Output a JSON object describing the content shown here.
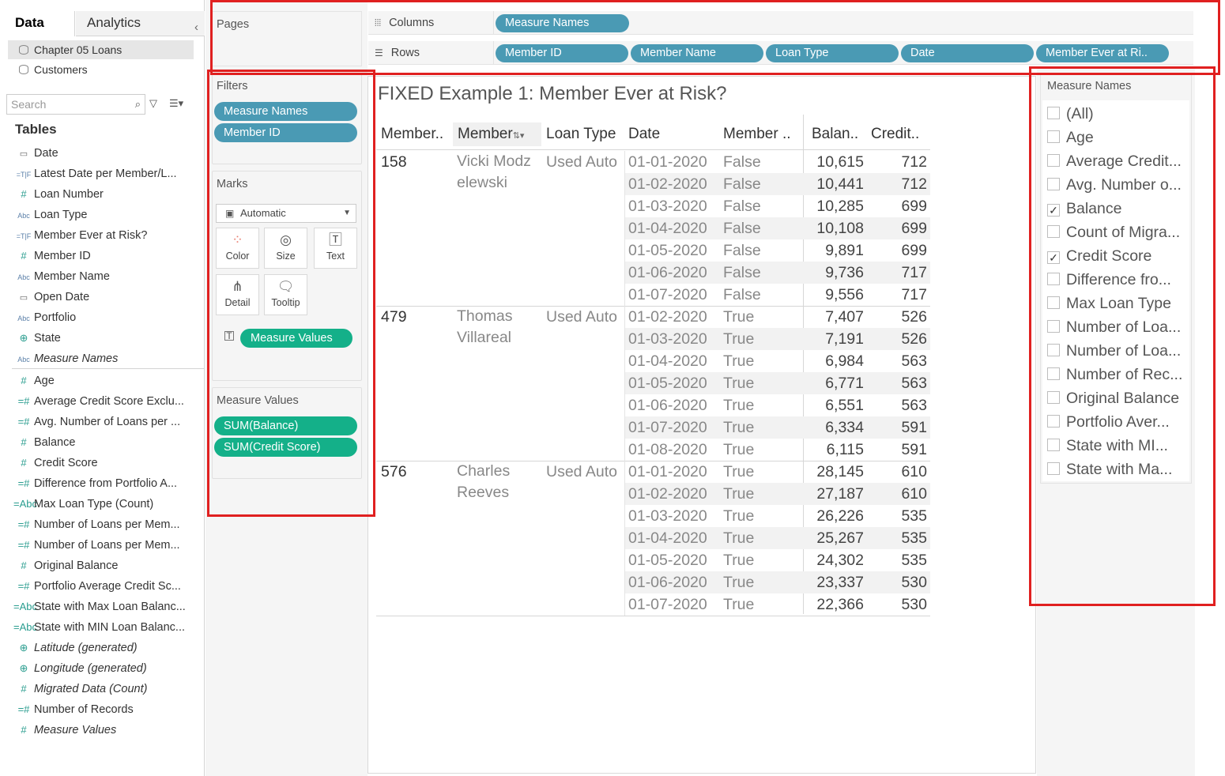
{
  "data_pane": {
    "tab_data": "Data",
    "tab_analytics": "Analytics",
    "collapse": "‹",
    "datasources": [
      "Chapter 05 Loans",
      "Customers"
    ],
    "search_placeholder": "Search",
    "tables_label": "Tables",
    "fields": [
      {
        "label": "Date",
        "icon": "date-icon",
        "glyph": "▭",
        "kind": "date"
      },
      {
        "label": "Latest Date per Member/L...",
        "icon": "calc-date-icon",
        "glyph": "=T|F",
        "kind": "dim"
      },
      {
        "label": "Loan Number",
        "icon": "hash-icon",
        "glyph": "#",
        "kind": "measure"
      },
      {
        "label": "Loan Type",
        "icon": "abc-icon",
        "glyph": "Abc",
        "kind": "dim"
      },
      {
        "label": "Member Ever at Risk?",
        "icon": "calc-bool-icon",
        "glyph": "=T|F",
        "kind": "dim"
      },
      {
        "label": "Member ID",
        "icon": "hash-icon",
        "glyph": "#",
        "kind": "measure"
      },
      {
        "label": "Member Name",
        "icon": "abc-icon",
        "glyph": "Abc",
        "kind": "dim"
      },
      {
        "label": "Open Date",
        "icon": "date-icon",
        "glyph": "▭",
        "kind": "date"
      },
      {
        "label": "Portfolio",
        "icon": "abc-icon",
        "glyph": "Abc",
        "kind": "dim"
      },
      {
        "label": "State",
        "icon": "globe-icon",
        "glyph": "⊕",
        "kind": "geo"
      },
      {
        "label": "Measure Names",
        "icon": "abc-icon",
        "glyph": "Abc",
        "kind": "dim",
        "italic": true
      },
      {
        "label": "Age",
        "icon": "hash-icon",
        "glyph": "#",
        "kind": "measure"
      },
      {
        "label": "Average Credit Score Exclu...",
        "icon": "calc-hash-icon",
        "glyph": "=#",
        "kind": "measure"
      },
      {
        "label": "Avg. Number of Loans per ...",
        "icon": "calc-hash-icon",
        "glyph": "=#",
        "kind": "measure"
      },
      {
        "label": "Balance",
        "icon": "hash-icon",
        "glyph": "#",
        "kind": "measure"
      },
      {
        "label": "Credit Score",
        "icon": "hash-icon",
        "glyph": "#",
        "kind": "measure"
      },
      {
        "label": "Difference from Portfolio A...",
        "icon": "calc-hash-icon",
        "glyph": "=#",
        "kind": "measure"
      },
      {
        "label": "Max Loan Type (Count)",
        "icon": "calc-abc-icon",
        "glyph": "=Abc",
        "kind": "measure"
      },
      {
        "label": "Number of Loans per Mem...",
        "icon": "calc-hash-icon",
        "glyph": "=#",
        "kind": "measure"
      },
      {
        "label": "Number of Loans per Mem...",
        "icon": "calc-hash-icon",
        "glyph": "=#",
        "kind": "measure"
      },
      {
        "label": "Original Balance",
        "icon": "hash-icon",
        "glyph": "#",
        "kind": "measure"
      },
      {
        "label": "Portfolio Average Credit Sc...",
        "icon": "calc-hash-icon",
        "glyph": "=#",
        "kind": "measure"
      },
      {
        "label": "State with Max Loan Balanc...",
        "icon": "calc-abc-icon",
        "glyph": "=Abc",
        "kind": "measure"
      },
      {
        "label": "State with MIN Loan Balanc...",
        "icon": "calc-abc-icon",
        "glyph": "=Abc",
        "kind": "measure"
      },
      {
        "label": "Latitude (generated)",
        "icon": "globe-icon",
        "glyph": "⊕",
        "kind": "geo",
        "italic": true
      },
      {
        "label": "Longitude (generated)",
        "icon": "globe-icon",
        "glyph": "⊕",
        "kind": "geo",
        "italic": true
      },
      {
        "label": "Migrated Data (Count)",
        "icon": "hash-icon",
        "glyph": "#",
        "kind": "measure",
        "italic": true
      },
      {
        "label": "Number of Records",
        "icon": "calc-hash-icon",
        "glyph": "=#",
        "kind": "measure"
      },
      {
        "label": "Measure Values",
        "icon": "hash-icon",
        "glyph": "#",
        "kind": "measure",
        "italic": true
      }
    ]
  },
  "cards": {
    "pages_label": "Pages",
    "filters_label": "Filters",
    "filters": [
      "Measure Names",
      "Member ID"
    ],
    "marks_label": "Marks",
    "mark_type": "Automatic",
    "mark_buttons": [
      {
        "label": "Color",
        "glyph": "●",
        "icon": "color-icon"
      },
      {
        "label": "Size",
        "glyph": "◎",
        "icon": "size-icon"
      },
      {
        "label": "Text",
        "glyph": "T",
        "icon": "text-icon"
      },
      {
        "label": "Detail",
        "glyph": "⋔",
        "icon": "detail-icon"
      },
      {
        "label": "Tooltip",
        "glyph": "▭",
        "icon": "tooltip-icon"
      }
    ],
    "marks_pill": "Measure Values",
    "measure_values_label": "Measure Values",
    "measure_values": [
      "SUM(Balance)",
      "SUM(Credit Score)"
    ]
  },
  "shelves": {
    "columns_label": "Columns",
    "columns": [
      "Measure Names"
    ],
    "rows_label": "Rows",
    "rows": [
      "Member ID",
      "Member Name",
      "Loan Type",
      "Date",
      "Member Ever at Ri.."
    ]
  },
  "view": {
    "title": "FIXED Example 1: Member Ever at Risk?",
    "headers": [
      "Member..",
      "Member",
      "Loan Type",
      "Date",
      "Member ..",
      "Balan..",
      "Credit.."
    ],
    "groups": [
      {
        "member_id": "158",
        "member_name": "Vicki Modz elewski",
        "loan_type": "Used Auto",
        "rows": [
          {
            "date": "01-01-2020",
            "flag": "False",
            "balance": "10,615",
            "credit": "712"
          },
          {
            "date": "01-02-2020",
            "flag": "False",
            "balance": "10,441",
            "credit": "712"
          },
          {
            "date": "01-03-2020",
            "flag": "False",
            "balance": "10,285",
            "credit": "699"
          },
          {
            "date": "01-04-2020",
            "flag": "False",
            "balance": "10,108",
            "credit": "699"
          },
          {
            "date": "01-05-2020",
            "flag": "False",
            "balance": "9,891",
            "credit": "699"
          },
          {
            "date": "01-06-2020",
            "flag": "False",
            "balance": "9,736",
            "credit": "717"
          },
          {
            "date": "01-07-2020",
            "flag": "False",
            "balance": "9,556",
            "credit": "717"
          }
        ]
      },
      {
        "member_id": "479",
        "member_name": "Thomas Villareal",
        "loan_type": "Used Auto",
        "rows": [
          {
            "date": "01-02-2020",
            "flag": "True",
            "balance": "7,407",
            "credit": "526"
          },
          {
            "date": "01-03-2020",
            "flag": "True",
            "balance": "7,191",
            "credit": "526"
          },
          {
            "date": "01-04-2020",
            "flag": "True",
            "balance": "6,984",
            "credit": "563"
          },
          {
            "date": "01-05-2020",
            "flag": "True",
            "balance": "6,771",
            "credit": "563"
          },
          {
            "date": "01-06-2020",
            "flag": "True",
            "balance": "6,551",
            "credit": "563"
          },
          {
            "date": "01-07-2020",
            "flag": "True",
            "balance": "6,334",
            "credit": "591"
          },
          {
            "date": "01-08-2020",
            "flag": "True",
            "balance": "6,115",
            "credit": "591"
          }
        ]
      },
      {
        "member_id": "576",
        "member_name": "Charles Reeves",
        "loan_type": "Used Auto",
        "rows": [
          {
            "date": "01-01-2020",
            "flag": "True",
            "balance": "28,145",
            "credit": "610"
          },
          {
            "date": "01-02-2020",
            "flag": "True",
            "balance": "27,187",
            "credit": "610"
          },
          {
            "date": "01-03-2020",
            "flag": "True",
            "balance": "26,226",
            "credit": "535"
          },
          {
            "date": "01-04-2020",
            "flag": "True",
            "balance": "25,267",
            "credit": "535"
          },
          {
            "date": "01-05-2020",
            "flag": "True",
            "balance": "24,302",
            "credit": "535"
          },
          {
            "date": "01-06-2020",
            "flag": "True",
            "balance": "23,337",
            "credit": "530"
          },
          {
            "date": "01-07-2020",
            "flag": "True",
            "balance": "22,366",
            "credit": "530"
          }
        ]
      }
    ]
  },
  "measure_names_filter": {
    "title": "Measure Names",
    "items": [
      {
        "label": "(All)",
        "checked": false
      },
      {
        "label": "Age",
        "checked": false
      },
      {
        "label": "Average Credit...",
        "checked": false
      },
      {
        "label": "Avg. Number o...",
        "checked": false
      },
      {
        "label": "Balance",
        "checked": true
      },
      {
        "label": "Count of Migra...",
        "checked": false
      },
      {
        "label": "Credit Score",
        "checked": true
      },
      {
        "label": "Difference fro...",
        "checked": false
      },
      {
        "label": "Max Loan Type",
        "checked": false
      },
      {
        "label": "Number of Loa...",
        "checked": false
      },
      {
        "label": "Number of Loa...",
        "checked": false
      },
      {
        "label": "Number of Rec...",
        "checked": false
      },
      {
        "label": "Original Balance",
        "checked": false
      },
      {
        "label": "Portfolio Aver...",
        "checked": false
      },
      {
        "label": "State with MI...",
        "checked": false
      },
      {
        "label": "State with Ma...",
        "checked": false
      }
    ]
  },
  "colors": {
    "dimension_pill": "#4a9ab4",
    "measure_pill": "#14b089",
    "annotation": "#e02020"
  }
}
